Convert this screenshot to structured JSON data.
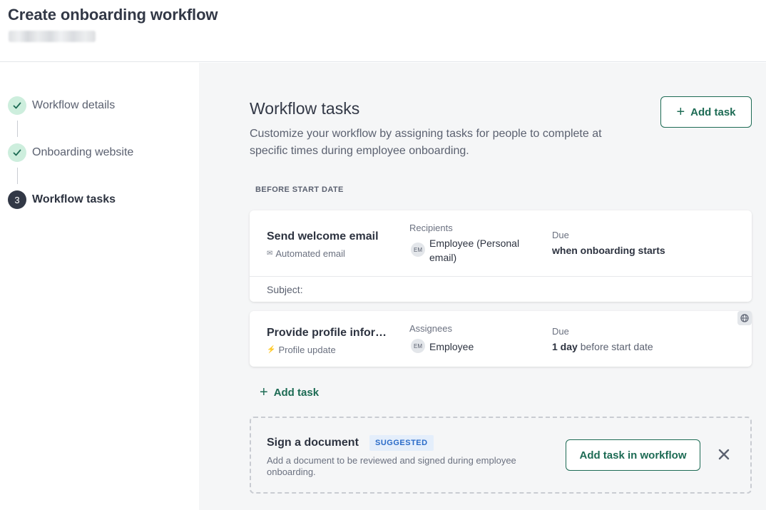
{
  "header": {
    "title": "Create onboarding workflow"
  },
  "sidebar": {
    "steps": [
      {
        "label": "Workflow details",
        "status": "done",
        "icon": "check-icon"
      },
      {
        "label": "Onboarding website",
        "status": "done",
        "icon": "check-icon"
      },
      {
        "label": "Workflow tasks",
        "status": "current",
        "number": "3"
      }
    ]
  },
  "main": {
    "title": "Workflow tasks",
    "description": "Customize your workflow by assigning tasks for people to complete at specific times during employee onboarding.",
    "add_task_button": "Add task",
    "group_label": "BEFORE START DATE",
    "tasks": [
      {
        "name": "Send welcome email",
        "type": "Automated email",
        "type_icon": "envelope-icon",
        "people_label": "Recipients",
        "avatar": "EM",
        "people": "Employee (Personal email)",
        "due_label": "Due",
        "due_bold": "when onboarding starts",
        "due_rest": "",
        "subject_label": "Subject:"
      },
      {
        "name": "Provide profile information",
        "type": "Profile update",
        "type_icon": "bolt-icon",
        "people_label": "Assignees",
        "avatar": "EM",
        "people": "Employee",
        "due_label": "Due",
        "due_bold": "1 day",
        "due_rest": "before start date"
      }
    ],
    "add_task_link": "Add task",
    "suggestion": {
      "title": "Sign a document",
      "badge": "SUGGESTED",
      "description": "Add a document to be reviewed and signed during employee onboarding.",
      "button": "Add task in workflow"
    }
  },
  "colors": {
    "accent": "#1d6b54",
    "done_step_bg": "#cdeedd",
    "badge_text": "#2a6bc8",
    "badge_bg": "#e4eefb"
  }
}
